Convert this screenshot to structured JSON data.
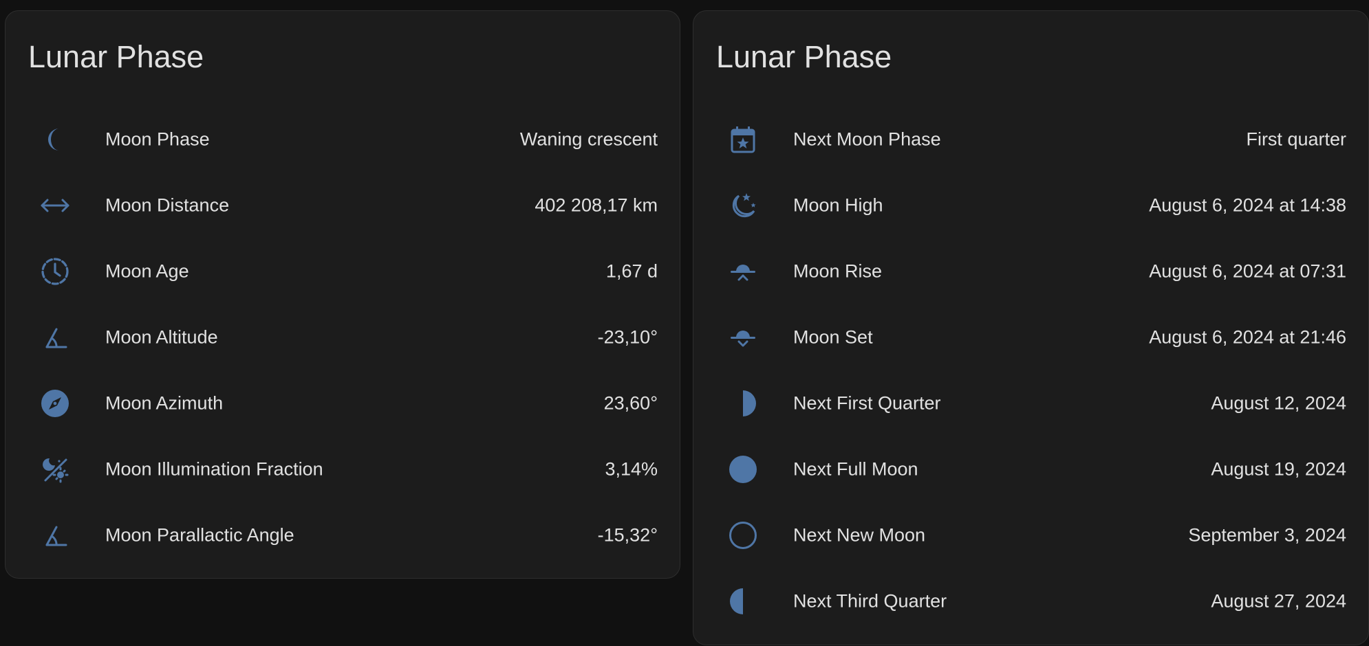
{
  "colors": {
    "icon": "#4f76a6",
    "card_bg": "#1c1c1c",
    "page_bg": "#111111",
    "text": "#e1e1e1"
  },
  "left_card": {
    "title": "Lunar Phase",
    "rows": [
      {
        "icon": "moon-crescent-icon",
        "label": "Moon Phase",
        "value": "Waning crescent"
      },
      {
        "icon": "arrow-left-right-icon",
        "label": "Moon Distance",
        "value": "402 208,17 km"
      },
      {
        "icon": "clock-outline-icon",
        "label": "Moon Age",
        "value": "1,67 d"
      },
      {
        "icon": "angle-icon",
        "label": "Moon Altitude",
        "value": "-23,10°"
      },
      {
        "icon": "compass-icon",
        "label": "Moon Azimuth",
        "value": "23,60°"
      },
      {
        "icon": "weather-night-partly-cloudy-icon",
        "label": "Moon Illumination Fraction",
        "value": "3,14%"
      },
      {
        "icon": "angle-icon",
        "label": "Moon Parallactic Angle",
        "value": "-15,32°"
      }
    ]
  },
  "right_card": {
    "title": "Lunar Phase",
    "rows": [
      {
        "icon": "calendar-star-icon",
        "label": "Next Moon Phase",
        "value": "First quarter"
      },
      {
        "icon": "weather-night-icon",
        "label": "Moon High",
        "value": "August 6, 2024 at 14:38"
      },
      {
        "icon": "moonrise-icon",
        "label": "Moon Rise",
        "value": "August 6, 2024 at 07:31"
      },
      {
        "icon": "moonset-icon",
        "label": "Moon Set",
        "value": "August 6, 2024 at 21:46"
      },
      {
        "icon": "moon-first-quarter-icon",
        "label": "Next First Quarter",
        "value": "August 12, 2024"
      },
      {
        "icon": "moon-full-icon",
        "label": "Next Full Moon",
        "value": "August 19, 2024"
      },
      {
        "icon": "moon-new-icon",
        "label": "Next New Moon",
        "value": "September 3, 2024"
      },
      {
        "icon": "moon-last-quarter-icon",
        "label": "Next Third Quarter",
        "value": "August 27, 2024"
      }
    ]
  }
}
